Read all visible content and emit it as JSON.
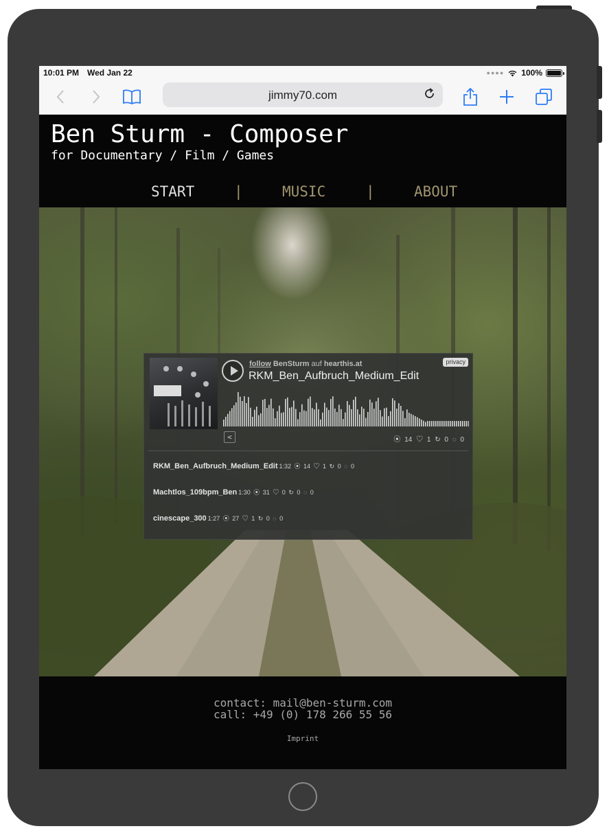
{
  "status_bar": {
    "time": "10:01 PM",
    "date": "Wed Jan 22",
    "battery": "100%",
    "icons": [
      "signal-dots-icon",
      "wifi-icon",
      "battery-icon"
    ]
  },
  "browser": {
    "url": "jimmy70.com",
    "icons": [
      "back-icon",
      "forward-icon",
      "bookmarks-icon",
      "reload-icon",
      "share-icon",
      "new-tab-icon",
      "tabs-icon"
    ]
  },
  "site": {
    "title": "Ben Sturm - Composer",
    "subtitle": "for Documentary / Film / Games",
    "nav": {
      "start": "START",
      "separator": "|",
      "music": "MUSIC",
      "about": "ABOUT"
    }
  },
  "player": {
    "follow": "follow",
    "artist": "BenSturm",
    "auf": "auf",
    "platform": "hearthis.at",
    "privacy": "privacy",
    "track_title": "RKM_Ben_Aufbruch_Medium_Edit",
    "stats": "⦿ 14 ♡ 1 ↻ 0 ◌ 0",
    "tracks": [
      {
        "name": "RKM_Ben_Aufbruch_Medium_Edit",
        "meta": "1:32 ⦿ 14 ♡ 1 ↻ 0 ◌ 0"
      },
      {
        "name": "Machtlos_109bpm_Ben",
        "meta": "1:30 ⦿ 31 ♡ 0 ↻ 0 ◌ 0"
      },
      {
        "name": "cinescape_300",
        "meta": "1:27 ⦿ 27 ♡ 1 ↻ 0 ◌ 0"
      }
    ]
  },
  "footer": {
    "contact": "contact: mail@ben-sturm.com",
    "call": "call: +49 (0) 178 266 55 56",
    "imprint": "Imprint"
  },
  "colors": {
    "nav_active": "#e0e0e0",
    "nav_inactive": "#a0956f",
    "page_bg": "#060606",
    "footer_text": "#a8a8a8"
  }
}
